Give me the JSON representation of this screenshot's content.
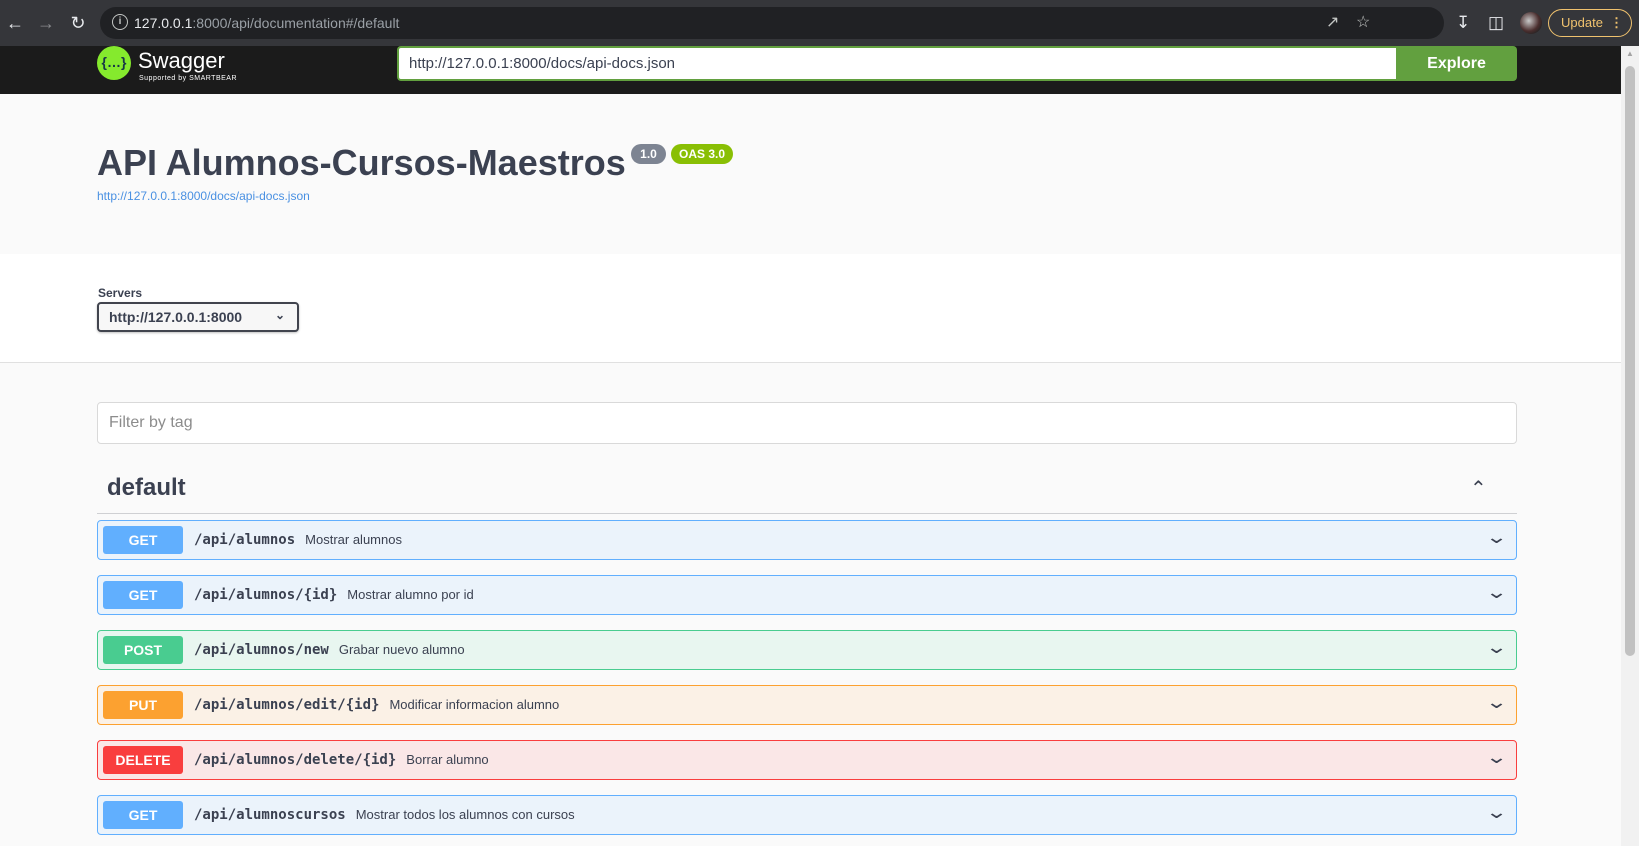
{
  "browser": {
    "url_host": "127.0.0.1",
    "url_rest": ":8000/api/documentation#/default",
    "update_label": "Update"
  },
  "topbar": {
    "logo_mark": "{…}",
    "logo_text": "Swagger",
    "logo_sub": "Supported by SMARTBEAR",
    "url_value": "http://127.0.0.1:8000/docs/api-docs.json",
    "explore_label": "Explore"
  },
  "info": {
    "title": "API Alumnos-Cursos-Maestros",
    "version": "1.0",
    "oas": "OAS 3.0",
    "spec_link": "http://127.0.0.1:8000/docs/api-docs.json"
  },
  "servers": {
    "label": "Servers",
    "selected": "http://127.0.0.1:8000"
  },
  "filter": {
    "placeholder": "Filter by tag"
  },
  "tag": {
    "name": "default"
  },
  "operations": [
    {
      "method": "GET",
      "path": "/api/alumnos",
      "summary": "Mostrar alumnos"
    },
    {
      "method": "GET",
      "path": "/api/alumnos/{id}",
      "summary": "Mostrar alumno por id"
    },
    {
      "method": "POST",
      "path": "/api/alumnos/new",
      "summary": "Grabar nuevo alumno"
    },
    {
      "method": "PUT",
      "path": "/api/alumnos/edit/{id}",
      "summary": "Modificar informacion alumno"
    },
    {
      "method": "DELETE",
      "path": "/api/alumnos/delete/{id}",
      "summary": "Borrar alumno"
    },
    {
      "method": "GET",
      "path": "/api/alumnoscursos",
      "summary": "Mostrar todos los alumnos con cursos"
    }
  ],
  "colors": {
    "get": "#61affe",
    "post": "#49cc90",
    "put": "#fca130",
    "delete": "#f93e3e",
    "explore": "#62a03f"
  }
}
